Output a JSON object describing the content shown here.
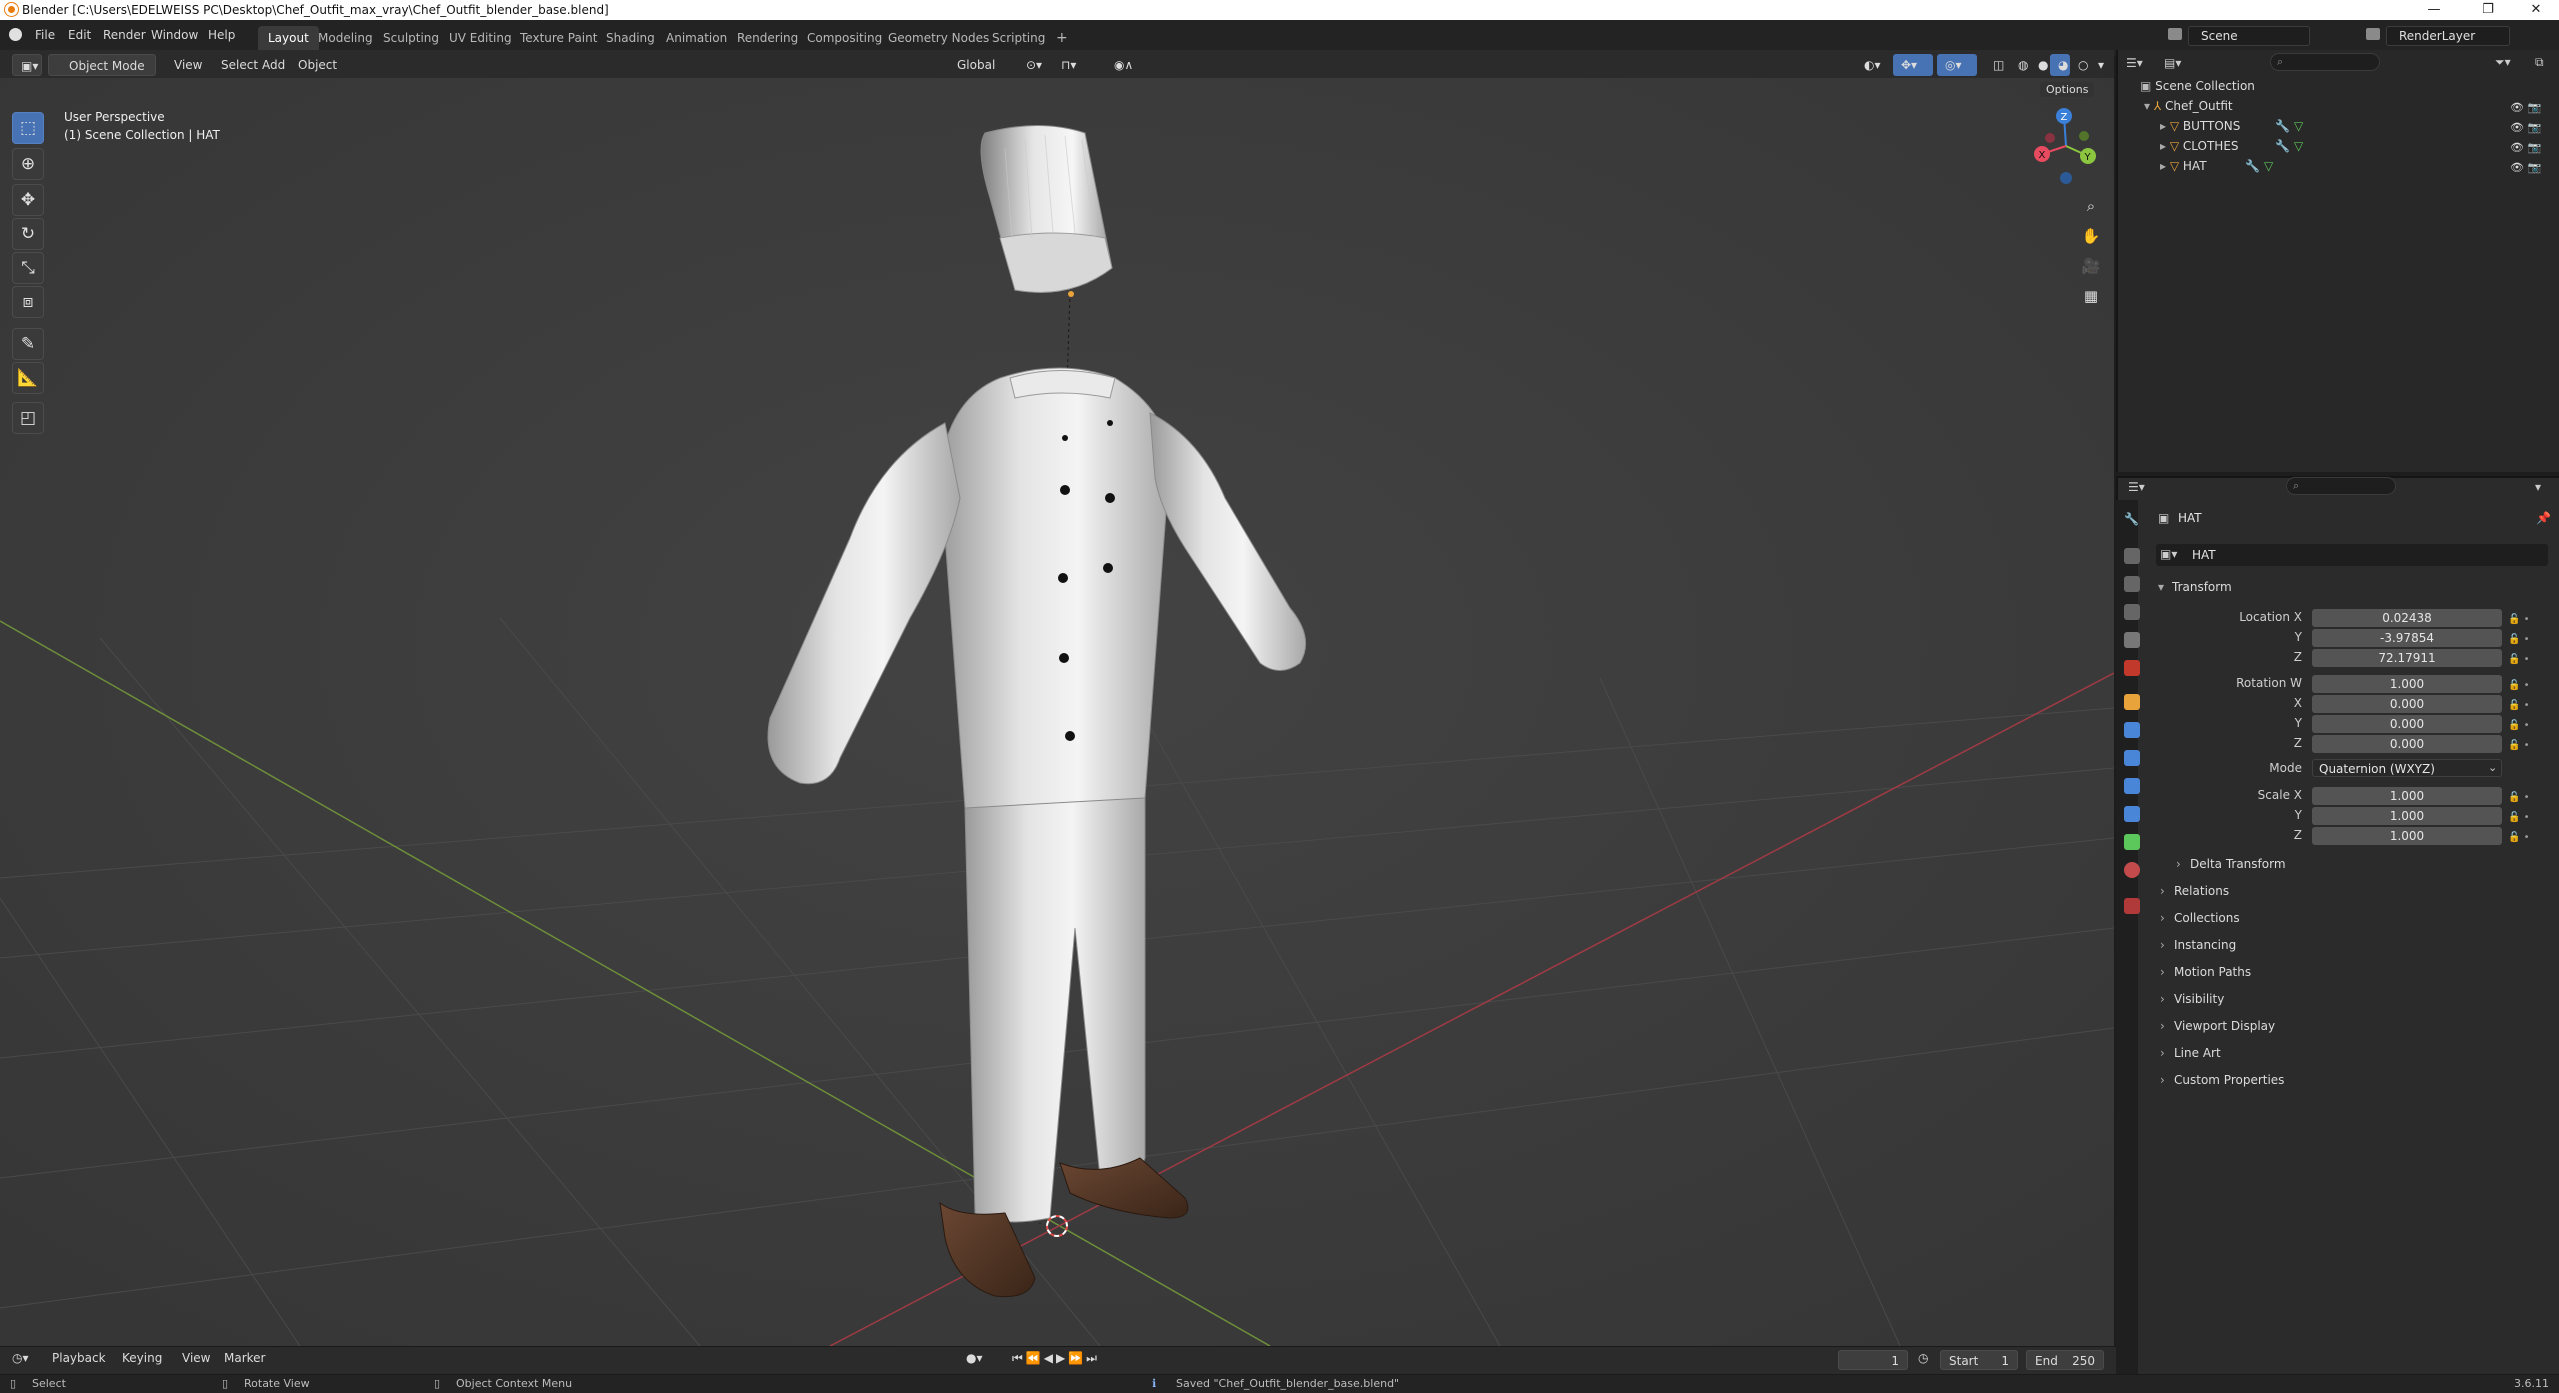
{
  "window": {
    "title": "Blender [C:\\Users\\EDELWEISS PC\\Desktop\\Chef_Outfit_max_vray\\Chef_Outfit_blender_base.blend]",
    "minimize": "—",
    "maximize": "❐",
    "close": "✕"
  },
  "menu": {
    "items": [
      "File",
      "Edit",
      "Render",
      "Window",
      "Help"
    ]
  },
  "workspaces": [
    "Layout",
    "Modeling",
    "Sculpting",
    "UV Editing",
    "Texture Paint",
    "Shading",
    "Animation",
    "Rendering",
    "Compositing",
    "Geometry Nodes",
    "Scripting"
  ],
  "workspace_add": "+",
  "scene": {
    "name": "Scene",
    "render_layer": "RenderLayer"
  },
  "viewport_header": {
    "mode": "Object Mode",
    "menus": [
      "View",
      "Select",
      "Add",
      "Object"
    ],
    "orientation": "Global",
    "options": "Options"
  },
  "viewport": {
    "perspective": "User Perspective",
    "collection_path": "(1) Scene Collection | HAT",
    "gizmo": {
      "z": "Z",
      "y": "Y",
      "x": "X"
    }
  },
  "tools": [
    "select-box",
    "cursor",
    "move",
    "rotate",
    "scale",
    "transform",
    "annotate",
    "measure",
    "add-cube"
  ],
  "outliner": {
    "root": "Scene Collection",
    "collection": "Chef_Outfit",
    "objects": [
      "BUTTONS",
      "CLOTHES",
      "HAT"
    ]
  },
  "properties": {
    "object_name": "HAT",
    "data_name": "HAT",
    "transform_header": "Transform",
    "location_label": "Location X",
    "location": {
      "x": "0.02438",
      "y": "-3.97854",
      "z": "72.17911"
    },
    "rotation_label": "Rotation W",
    "rotation": {
      "w": "1.000",
      "x": "0.000",
      "y": "0.000",
      "z": "0.000"
    },
    "mode_label": "Mode",
    "mode_value": "Quaternion (WXYZ)",
    "scale_label": "Scale X",
    "scale": {
      "x": "1.000",
      "y": "1.000",
      "z": "1.000"
    },
    "axis_labels": {
      "x": "X",
      "y": "Y",
      "z": "Z"
    },
    "delta_transform": "Delta Transform",
    "panels": [
      "Relations",
      "Collections",
      "Instancing",
      "Motion Paths",
      "Visibility",
      "Viewport Display",
      "Line Art",
      "Custom Properties"
    ]
  },
  "timeline": {
    "menus": [
      "Playback",
      "Keying",
      "View",
      "Marker"
    ],
    "current_frame": "1",
    "start_label": "Start",
    "start": "1",
    "end_label": "End",
    "end": "250"
  },
  "status": {
    "select": "Select",
    "rotate_view": "Rotate View",
    "context_menu": "Object Context Menu",
    "message": "Saved \"Chef_Outfit_blender_base.blend\"",
    "version": "3.6.11"
  },
  "colors": {
    "accent": "#4772b3",
    "x_axis": "#e84a5f",
    "y_axis": "#8cc640",
    "z_axis": "#3a7fd8",
    "mesh_tri": "#e8a33a",
    "mesh_tri_green": "#5cc75a"
  }
}
